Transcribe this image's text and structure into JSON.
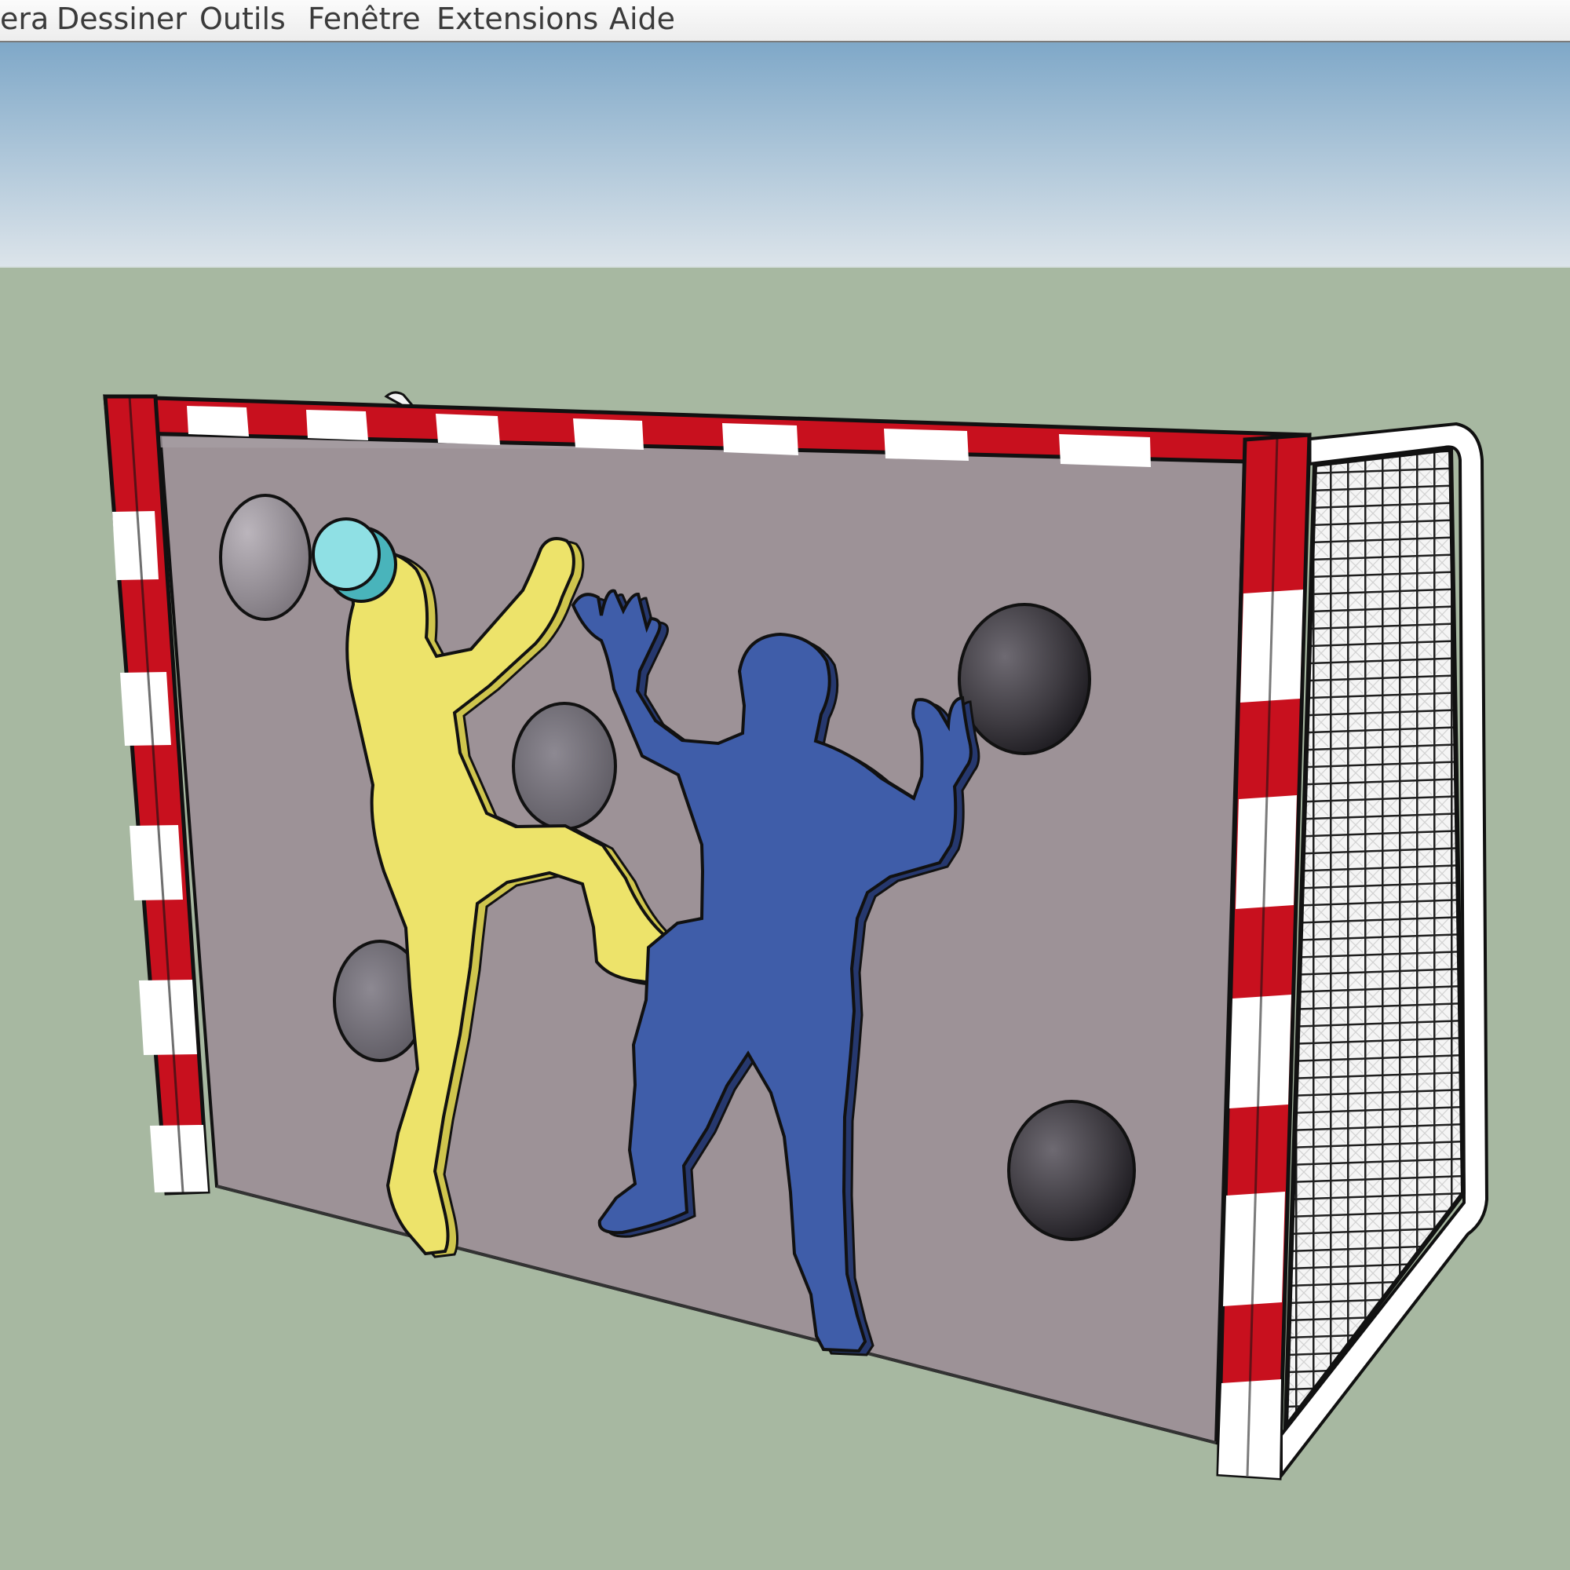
{
  "menu": {
    "items": [
      {
        "label": "era"
      },
      {
        "label": "Dessiner"
      },
      {
        "label": "Outils"
      },
      {
        "label": "Fenêtre"
      },
      {
        "label": "Extensions"
      },
      {
        "label": "Aide"
      }
    ]
  },
  "scene": {
    "sky_top_color": "#7fa8c8",
    "sky_bottom_color": "#dce4ea",
    "ground_color": "#a7b8a1",
    "goal_post_red": "#c8101e",
    "goal_post_white": "#ffffff",
    "panel_color": "#9d9297",
    "yellow_figure_color": "#ede36a",
    "blue_figure_color": "#3f5da9",
    "ball_color": "#8fe0e4",
    "net_color": "#1f1f1f"
  }
}
